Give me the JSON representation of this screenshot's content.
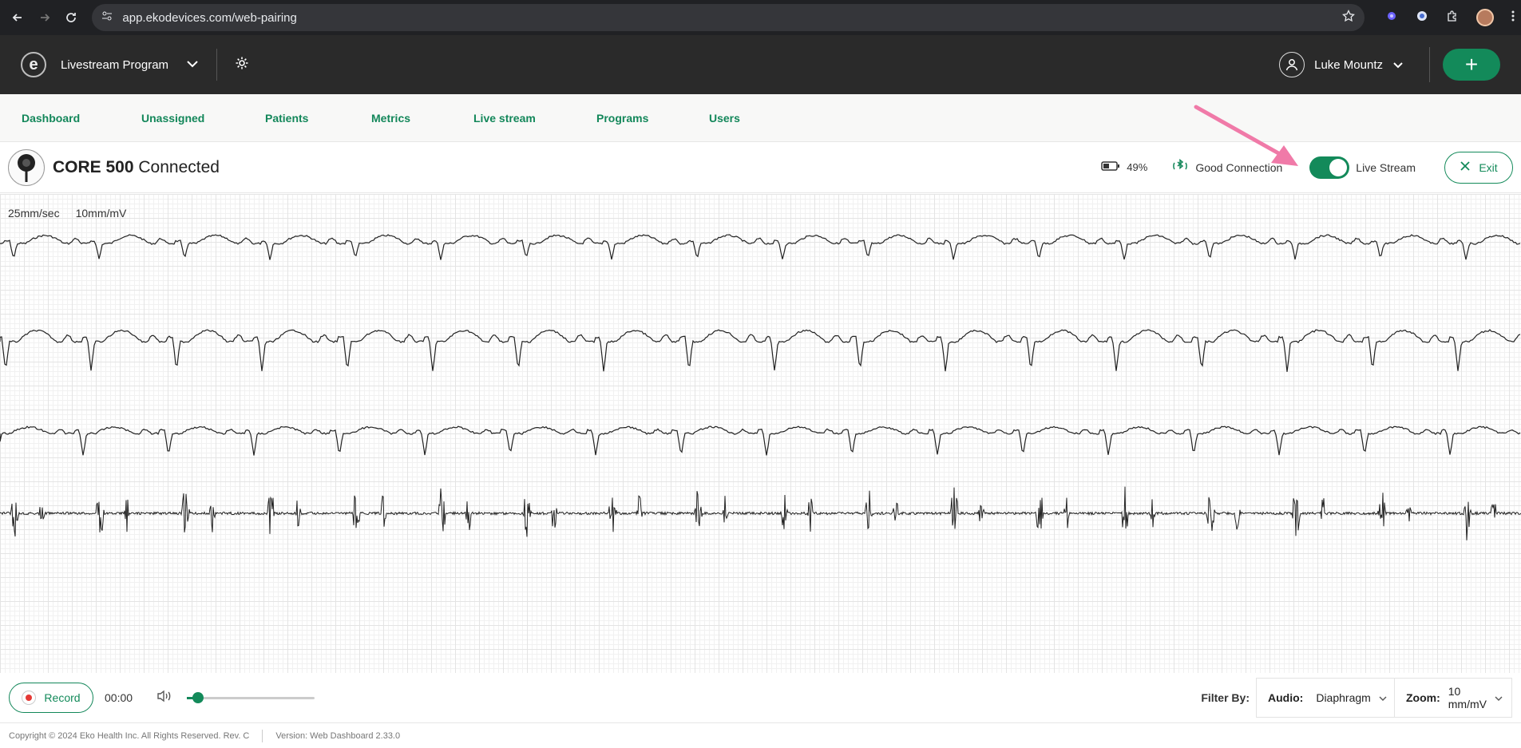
{
  "browser": {
    "url": "app.ekodevices.com/web-pairing"
  },
  "header": {
    "program_name": "Livestream Program",
    "user_name": "Luke Mountz",
    "add_label": "+"
  },
  "tabs": [
    {
      "label": "Dashboard"
    },
    {
      "label": "Unassigned"
    },
    {
      "label": "Patients"
    },
    {
      "label": "Metrics"
    },
    {
      "label": "Live stream"
    },
    {
      "label": "Programs"
    },
    {
      "label": "Users"
    }
  ],
  "device": {
    "model": "CORE 500",
    "status": "Connected",
    "battery": "49%",
    "connection": "Good Connection",
    "live_stream_label": "Live Stream",
    "live_stream_on": true,
    "exit_label": "Exit"
  },
  "ecg": {
    "speed": "25mm/sec",
    "gain": "10mm/mV"
  },
  "controls": {
    "record_label": "Record",
    "time": "00:00",
    "volume_level": 0.09,
    "filter_label": "Filter By:",
    "audio_label": "Audio:",
    "audio_value": "Diaphragm",
    "zoom_label": "Zoom:",
    "zoom_value": "10 mm/mV"
  },
  "footer": {
    "copyright": "Copyright © 2024 Eko Health Inc. All Rights Reserved. Rev. C",
    "version": "Version: Web Dashboard 2.33.0"
  },
  "colors": {
    "accent": "#138a5a",
    "header_bg": "#2a2a2a",
    "annotation_arrow": "#f07aa8"
  }
}
